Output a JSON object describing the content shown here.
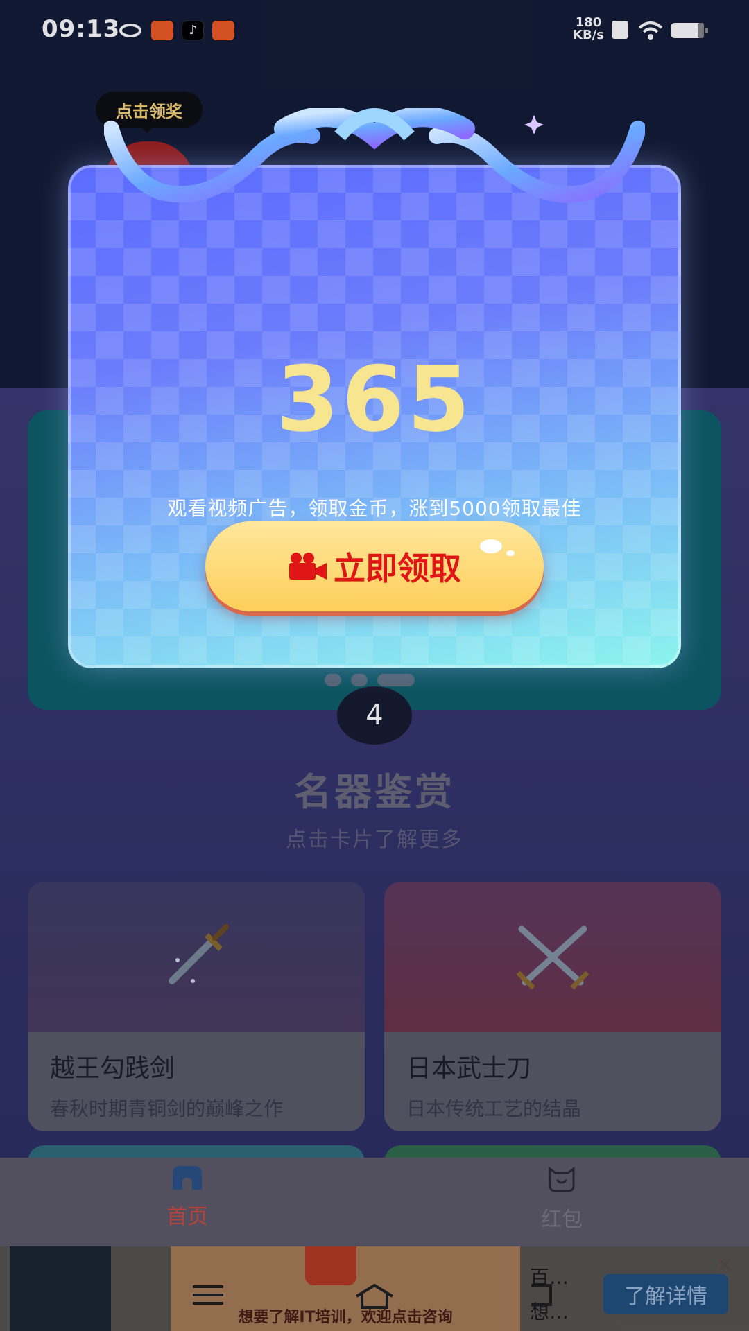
{
  "status_bar": {
    "time": "09:13",
    "net_speed_top": "180",
    "net_speed_unit": "KB/s"
  },
  "banner": {
    "countdown": "4"
  },
  "section": {
    "title": "名器鉴赏",
    "subtitle": "点击卡片了解更多"
  },
  "cards": [
    {
      "title": "越王勾践剑",
      "desc": "春秋时期青铜剑的巅峰之作"
    },
    {
      "title": "日本武士刀",
      "desc": "日本传统工艺的结晶"
    }
  ],
  "tabs": [
    {
      "label": "首页",
      "color": "#d04a3e"
    },
    {
      "label": "红包",
      "color": "#7a7880"
    }
  ],
  "ad": {
    "text": "想要了解IT培训，欢迎点击咨询",
    "right_line1": "百…",
    "right_line2": "想…",
    "button": "了解详情"
  },
  "popup": {
    "tooltip": "点击领奖",
    "amount": "365",
    "description": "观看视频广告，领取金币，涨到5000领取最佳",
    "claim_button": "立即领取"
  }
}
